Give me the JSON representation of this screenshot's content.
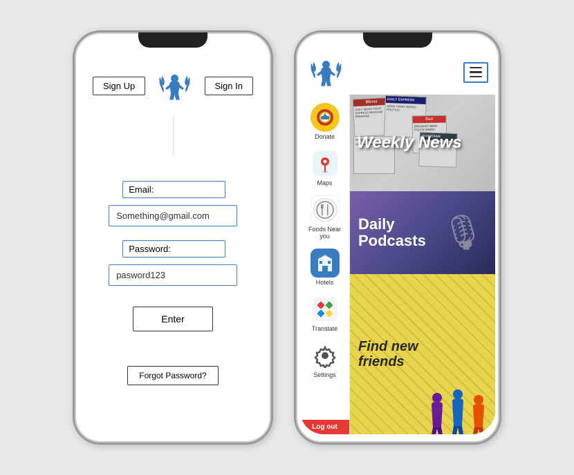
{
  "phones": {
    "left": {
      "header": {
        "signup_label": "Sign Up",
        "signin_label": "Sign In"
      },
      "form": {
        "email_label": "Email:",
        "email_value": "Something@gmail.com",
        "password_label": "Password:",
        "password_value": "pasword123",
        "enter_label": "Enter",
        "forgot_label": "Forgot Password?"
      }
    },
    "right": {
      "header": {
        "hamburger_aria": "Menu"
      },
      "sidebar": {
        "items": [
          {
            "id": "donate",
            "label": "Donate",
            "icon": "🛖"
          },
          {
            "id": "maps",
            "label": "Maps",
            "icon": "📍"
          },
          {
            "id": "foods",
            "label": "Foods Near you",
            "icon": "🍽"
          },
          {
            "id": "hotels",
            "label": "Hotels",
            "icon": "🏨"
          },
          {
            "id": "translate",
            "label": "Translate",
            "icon": "🔀"
          },
          {
            "id": "settings",
            "label": "Settings",
            "icon": "⚙"
          }
        ],
        "logout_label": "Log out"
      },
      "cards": {
        "weekly_news": "Weekly News",
        "daily_podcasts": "Daily\nPodcasts",
        "find_friends": "Find new\nfriends"
      }
    }
  }
}
